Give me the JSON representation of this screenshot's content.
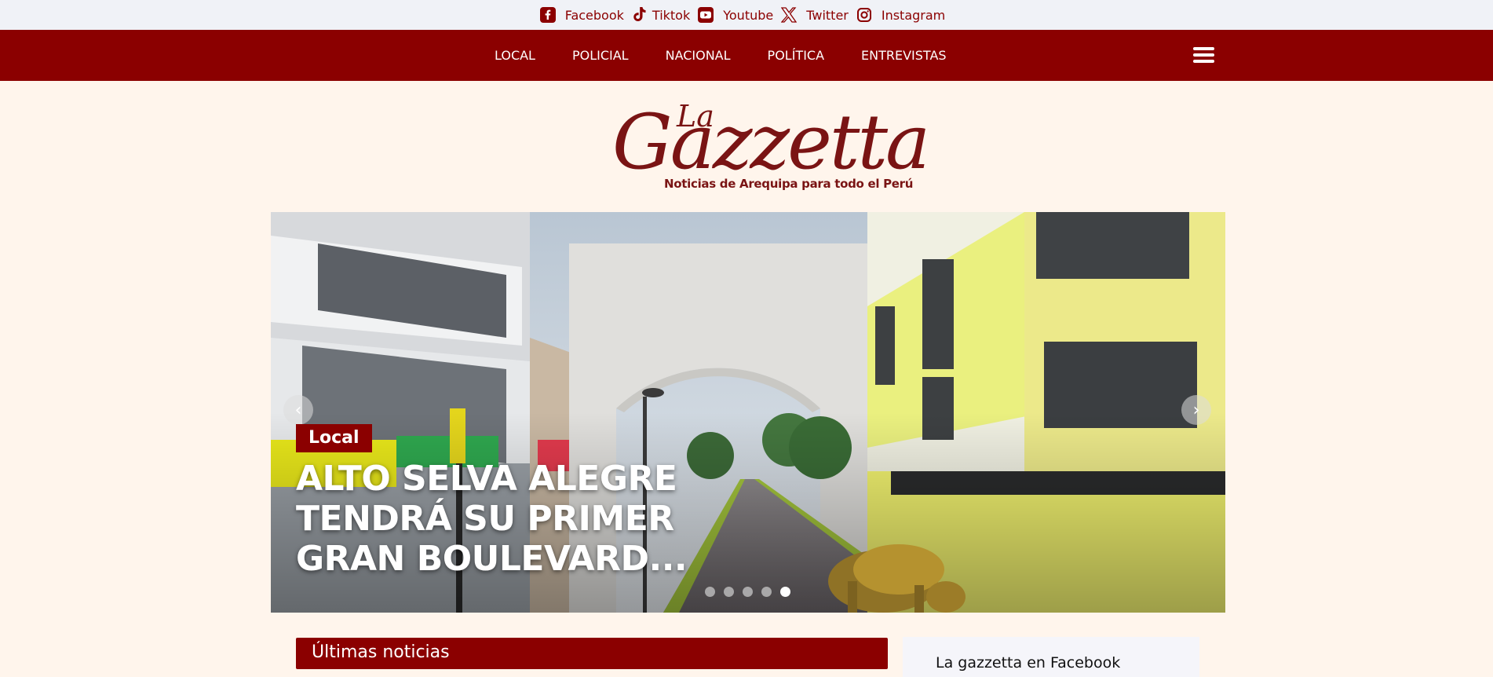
{
  "social": {
    "items": [
      {
        "label": "Facebook",
        "icon": "facebook-icon"
      },
      {
        "label": "Tiktok",
        "icon": "tiktok-icon"
      },
      {
        "label": "Youtube",
        "icon": "youtube-icon"
      },
      {
        "label": "Twitter",
        "icon": "x-twitter-icon"
      },
      {
        "label": "Instagram",
        "icon": "instagram-icon"
      }
    ]
  },
  "nav": {
    "links": [
      "LOCAL",
      "POLICIAL",
      "NACIONAL",
      "POLÍTICA",
      "ENTREVISTAS"
    ],
    "menu_icon": "hamburger-menu-icon"
  },
  "logo": {
    "prefix": "La",
    "name": "Gazzetta",
    "tagline": "Noticias de Arequipa para todo el Perú"
  },
  "slider": {
    "category": "Local",
    "title": "ALTO SELVA ALEGRE TENDRÁ SU PRIMER GRAN BOULEVARD...",
    "dot_count": 5,
    "active_dot": 5,
    "prev_icon": "chevron-left-icon",
    "next_icon": "chevron-right-icon"
  },
  "sections": {
    "latest_title": "Últimas noticias",
    "facebook_title": "La gazzetta en Facebook"
  },
  "colors": {
    "brand": "#8b0000",
    "background": "#fff5ec",
    "topbar": "#f0f2f7"
  }
}
